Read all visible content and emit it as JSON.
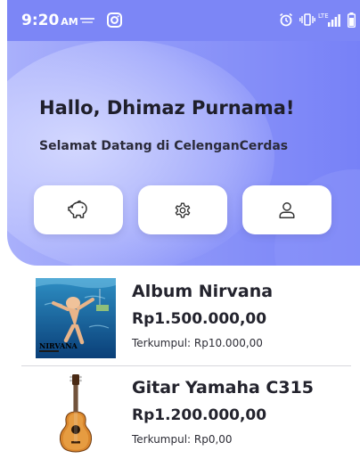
{
  "status_bar": {
    "time": "9:20",
    "ampm": "AM",
    "network_label": "LTE"
  },
  "header": {
    "greeting": "Hallo, Dhimaz Purnama!",
    "subtitle": "Selamat Datang di CelenganCerdas"
  },
  "actions": [
    {
      "icon": "piggy-bank-icon"
    },
    {
      "icon": "gear-icon"
    },
    {
      "icon": "user-icon"
    }
  ],
  "items": [
    {
      "title": "Album Nirvana",
      "price": "Rp1.500.000,00",
      "collected": "Terkumpul: Rp10.000,00",
      "thumb_label": "NIRVANA"
    },
    {
      "title": "Gitar Yamaha C315",
      "price": "Rp1.200.000,00",
      "collected": "Terkumpul: Rp0,00"
    }
  ],
  "colors": {
    "header_gradient_start": "#a9b0fb",
    "header_gradient_end": "#7781f7",
    "status_bar": "#7c86f6"
  }
}
